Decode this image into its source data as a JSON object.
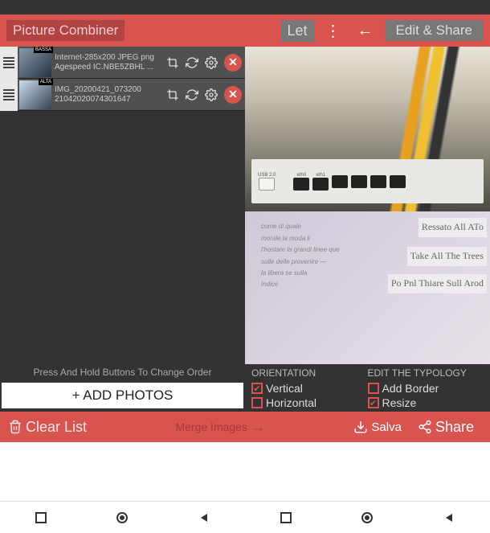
{
  "header": {
    "title": "Picture Combiner",
    "let_label": "Let",
    "edit_share": "Edit & Share"
  },
  "photos": [
    {
      "badge": "BASSA",
      "line1": "Internet-285x200 JPEG png",
      "line2": "Agespeed IC.NBE5ZBHL ..."
    },
    {
      "badge": "ALTA",
      "line1": "IMG_20200421_073200",
      "line2": "21042020074301647"
    }
  ],
  "left": {
    "hold_hint": "Press And Hold Buttons To Change Order",
    "add_photos": "+ ADD PHOTOS"
  },
  "preview": {
    "ports": [
      "USB 2.0",
      "eth0",
      "eth1"
    ],
    "overlay1": "Ressato All ATo",
    "overlay2": "Take All The Trees",
    "overlay3": "Po Pnl Thiare Sull Arod",
    "doc_lorem": "come di quale\nmorale la moda li\nl'hostare la grandi linee que\nsulle delle provenire —\nla libera se sulla\nIndice"
  },
  "options": {
    "orientation_header": "ORIENTATION",
    "vertical": "Vertical",
    "horizontal": "Horizontal",
    "typology_header": "EDIT THE TYPOLOGY",
    "add_border": "Add Border",
    "resize": "Resize"
  },
  "footer": {
    "clear": "Clear List",
    "merge": "Merge Images",
    "save": "Salva",
    "share": "Share"
  }
}
